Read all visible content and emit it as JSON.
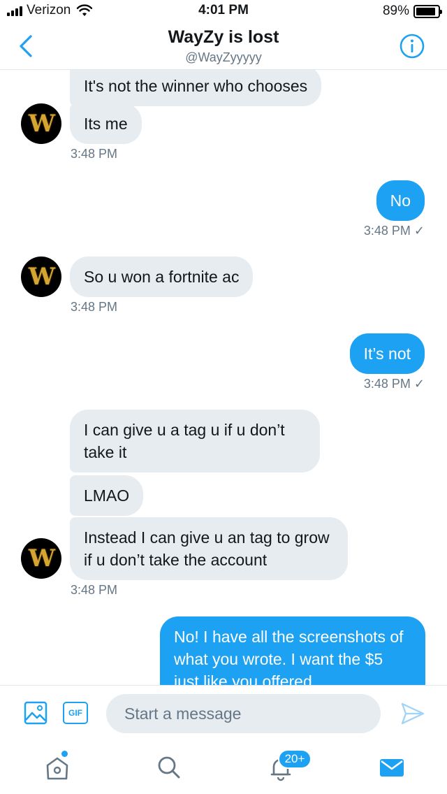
{
  "status_bar": {
    "carrier": "Verizon",
    "time": "4:01 PM",
    "battery": "89%",
    "battery_level": 0.89
  },
  "header": {
    "title": "WayZy is lost",
    "handle": "@WayZyyyyy"
  },
  "messages": [
    {
      "direction": "incoming",
      "text": "It's not the winner who chooses"
    },
    {
      "direction": "incoming",
      "text": "Its me"
    },
    {
      "direction": "timestamp",
      "text": "3:48 PM"
    },
    {
      "direction": "outgoing",
      "text": "No"
    },
    {
      "direction": "timestamp",
      "text": "3:48 PM ✓"
    },
    {
      "direction": "incoming",
      "text": "So u won a fortnite ac"
    },
    {
      "direction": "timestamp",
      "text": "3:48 PM"
    },
    {
      "direction": "outgoing",
      "text": "It’s not"
    },
    {
      "direction": "timestamp",
      "text": "3:48 PM ✓"
    },
    {
      "direction": "incoming",
      "text": "I can give u a tag u if u don’t take it"
    },
    {
      "direction": "incoming",
      "text": "LMAO"
    },
    {
      "direction": "incoming",
      "text": "Instead I can give u an tag to grow  if u don’t take the account"
    },
    {
      "direction": "timestamp",
      "text": "3:48 PM"
    },
    {
      "direction": "outgoing",
      "text": "No!  I have all the screenshots of what you wrote.  I want the $5 just like you offered"
    }
  ],
  "avatar": {
    "letter": "W"
  },
  "composer": {
    "gif_label": "GIF",
    "placeholder": "Start a message"
  },
  "tabbar": {
    "notifications_badge": "20+"
  },
  "colors": {
    "accent": "#1da1f2",
    "incoming_bubble": "#e6ecf0",
    "secondary_text": "#657786"
  }
}
